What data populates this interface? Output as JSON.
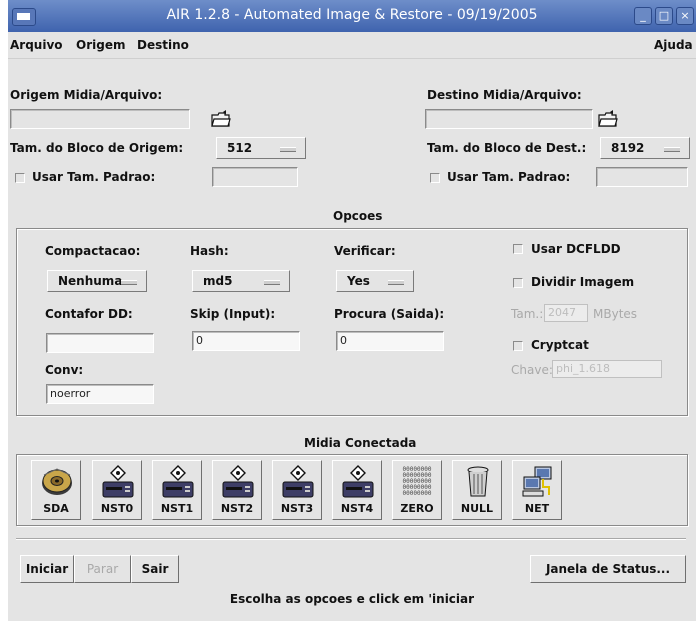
{
  "window": {
    "title": "AIR 1.2.8 - Automated Image & Restore - 09/19/2005"
  },
  "menu": {
    "arquivo": "Arquivo",
    "origem": "Origem",
    "destino": "Destino",
    "ajuda": "Ajuda"
  },
  "origem": {
    "label": "Origem Midia/Arquivo:",
    "path": "",
    "block_label": "Tam. do Bloco de Origem:",
    "block_value": "512",
    "default_label": "Usar Tam. Padrao:",
    "default_value": ""
  },
  "destino": {
    "label": "Destino Midia/Arquivo:",
    "path": "",
    "block_label": "Tam. do Bloco de Dest.:",
    "block_value": "8192",
    "default_label": "Usar Tam. Padrao:",
    "default_value": ""
  },
  "opcoes": {
    "title": "Opcoes",
    "compactacao_label": "Compactacao:",
    "compactacao_value": "Nenhuma",
    "hash_label": "Hash:",
    "hash_value": "md5",
    "verificar_label": "Verificar:",
    "verificar_value": "Yes",
    "usar_dcfldd": "Usar DCFLDD",
    "dividir_imagem": "Dividir Imagem",
    "tam_label": "Tam.:",
    "tam_value": "2047",
    "tam_unit": "MBytes",
    "contador_label": "Contafor DD:",
    "contador_value": "",
    "skip_label": "Skip (Input):",
    "skip_value": "0",
    "procura_label": "Procura (Saida):",
    "procura_value": "0",
    "cryptcat": "Cryptcat",
    "chave_label": "Chave:",
    "chave_value": "phi_1.618",
    "conv_label": "Conv:",
    "conv_value": "noerror"
  },
  "midia": {
    "title": "Midia Conectada",
    "items": [
      {
        "label": "SDA",
        "icon": "disk-icon"
      },
      {
        "label": "NST0",
        "icon": "tape-drive-icon"
      },
      {
        "label": "NST1",
        "icon": "tape-drive-icon"
      },
      {
        "label": "NST2",
        "icon": "tape-drive-icon"
      },
      {
        "label": "NST3",
        "icon": "tape-drive-icon"
      },
      {
        "label": "NST4",
        "icon": "tape-drive-icon"
      },
      {
        "label": "ZERO",
        "icon": "zeros-icon",
        "glyph": "00000000"
      },
      {
        "label": "NULL",
        "icon": "trash-icon"
      },
      {
        "label": "NET",
        "icon": "network-icon"
      }
    ]
  },
  "buttons": {
    "iniciar": "Iniciar",
    "parar": "Parar",
    "sair": "Sair",
    "janela": "Janela de Status..."
  },
  "status": {
    "message": "Escolha as opcoes e click em 'iniciar"
  },
  "colors": {
    "titlebar": "#4f72b8",
    "background": "#e4e4e4",
    "disabled_text": "#a9a9a9"
  }
}
